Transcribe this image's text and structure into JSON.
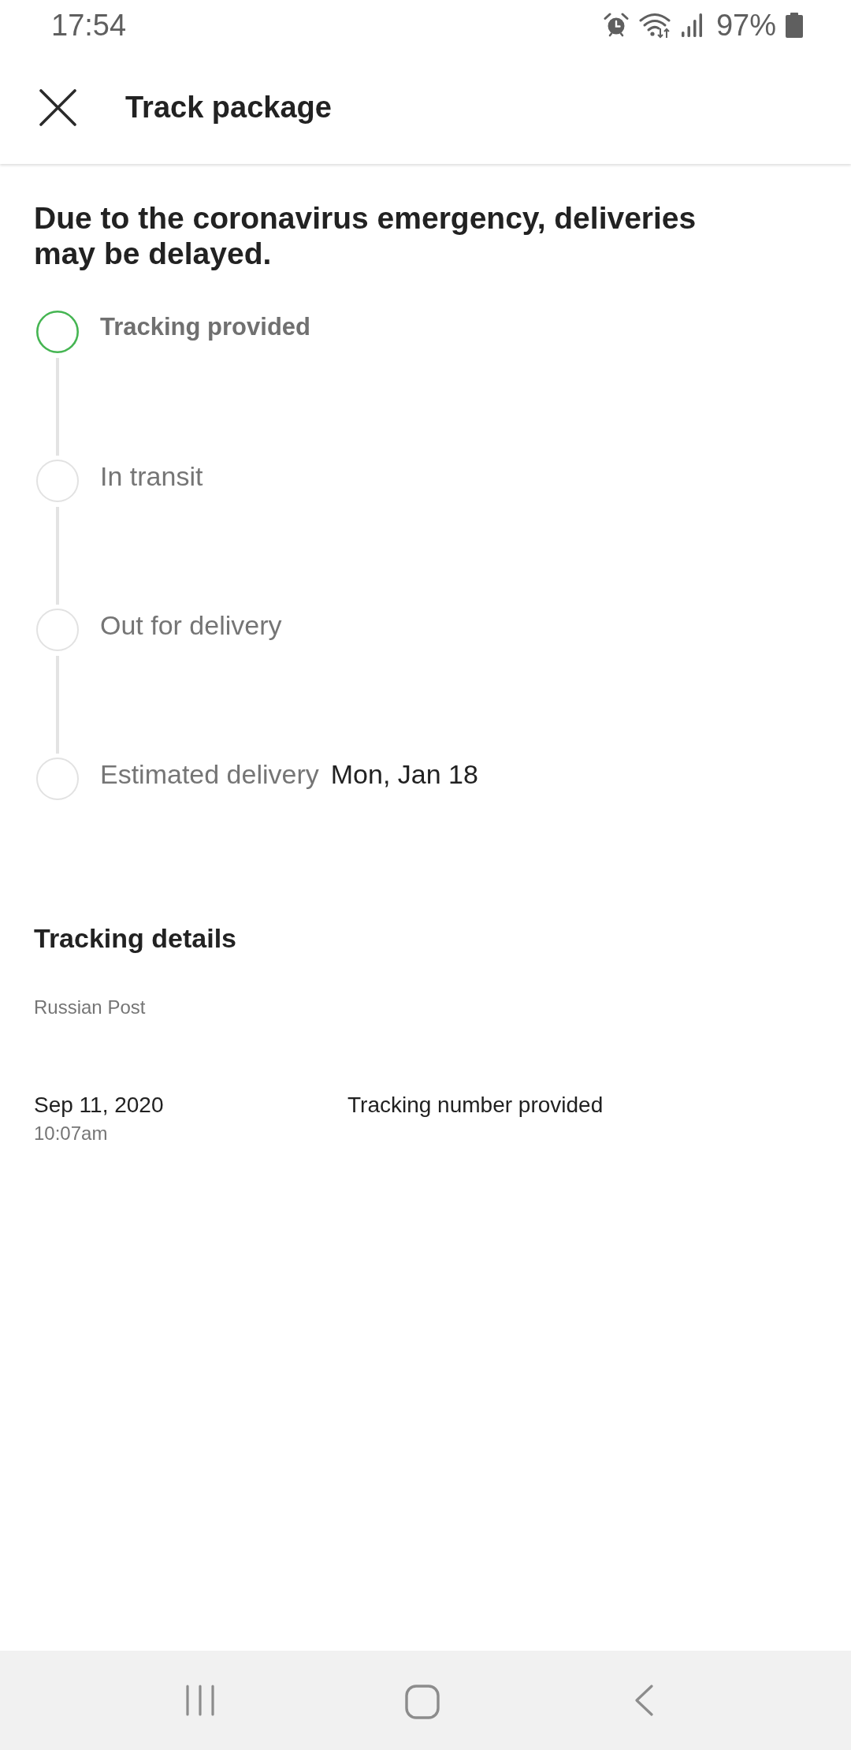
{
  "status_bar": {
    "time": "17:54",
    "battery": "97%"
  },
  "app_bar": {
    "title": "Track package"
  },
  "notice": "Due to the coronavirus emergency, deliveries may be delayed.",
  "steps": [
    {
      "label": "Tracking provided",
      "done": true
    },
    {
      "label": "In transit",
      "done": false
    },
    {
      "label": "Out for delivery",
      "done": false
    },
    {
      "label": "Estimated delivery",
      "done": false,
      "value": "Mon, Jan 18"
    }
  ],
  "tracking_details": {
    "title": "Tracking details",
    "carrier": "Russian Post",
    "events": [
      {
        "date": "Sep 11, 2020",
        "time": "10:07am",
        "description": "Tracking number provided"
      }
    ]
  }
}
